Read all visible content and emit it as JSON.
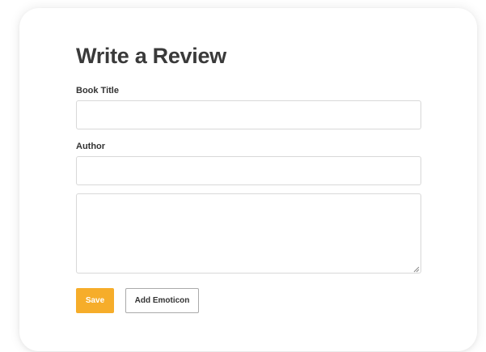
{
  "form": {
    "title": "Write a Review",
    "book_title_label": "Book Title",
    "book_title_value": "",
    "author_label": "Author",
    "author_value": "",
    "review_value": "",
    "save_label": "Save",
    "add_emoticon_label": "Add Emoticon"
  },
  "colors": {
    "accent": "#f6ad2a",
    "card_background": "#ffffff",
    "text": "#333333",
    "input_border": "#d8d8d8"
  }
}
